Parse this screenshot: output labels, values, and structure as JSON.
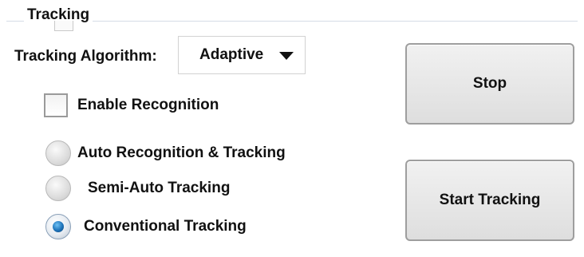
{
  "group": {
    "title": "Tracking"
  },
  "algorithm": {
    "label": "Tracking Algorithm:",
    "value": "Adaptive"
  },
  "enable_recognition": {
    "label": "Enable Recognition",
    "checked": false
  },
  "modes": [
    {
      "label": "Auto Recognition & Tracking",
      "checked": false
    },
    {
      "label": "Semi-Auto Tracking",
      "checked": false
    },
    {
      "label": "Conventional Tracking",
      "checked": true
    }
  ],
  "buttons": {
    "stop": "Stop",
    "start": "Start Tracking"
  },
  "colors": {
    "radio_selected": "#1e73b9",
    "button_face": "#e8e8e8",
    "group_line": "#d6dce6"
  }
}
